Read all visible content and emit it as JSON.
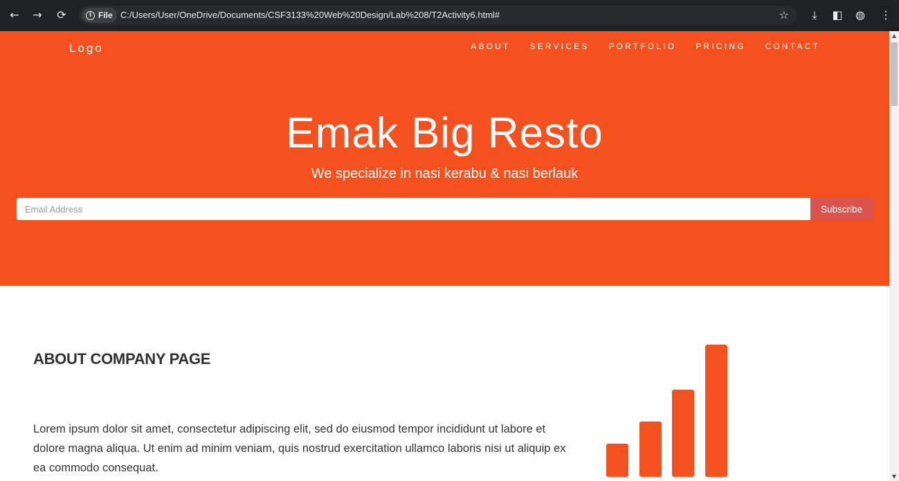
{
  "browser": {
    "back_icon": "←",
    "forward_icon": "→",
    "reload_icon": "⟳",
    "site_chip_label": "File",
    "url": "C:/Users/User/OneDrive/Documents/CSF3133%20Web%20Design/Lab%208/T2Activity6.html#",
    "bookmark_icon": "☆",
    "download_icon": "⤓",
    "sidepanel_icon": "◧",
    "extension_icon": "◍",
    "menu_icon": "⋮"
  },
  "page": {
    "logo": "Logo",
    "nav": [
      "ABOUT",
      "SERVICES",
      "PORTFOLIO",
      "PRICING",
      "CONTACT"
    ],
    "hero_title": "Emak Big Resto",
    "hero_subtitle": "We specialize in nasi kerabu & nasi berlauk",
    "email_placeholder": "Email Address",
    "subscribe_label": "Subscribe",
    "about_heading": "ABOUT COMPANY PAGE",
    "about_text": "Lorem ipsum dolor sit amet, consectetur adipiscing elit, sed do eiusmod tempor incididunt ut labore et dolore magna aliqua. Ut enim ad minim veniam, quis nostrud exercitation ullamco laboris nisi ut aliquip ex ea commodo consequat."
  },
  "icon_chart": {
    "name": "signal-bars-icon",
    "bar_levels": [
      0.25,
      0.42,
      0.66,
      1.0
    ],
    "color": "#f4511e"
  },
  "colors": {
    "hero_bg": "#f4511e",
    "subscribe_bg": "#d9534f",
    "chrome_bg": "#202124"
  }
}
